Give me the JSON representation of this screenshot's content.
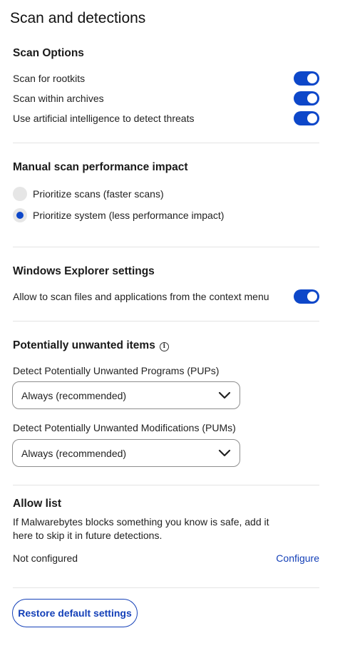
{
  "page": {
    "title": "Scan and detections"
  },
  "scan_options": {
    "heading": "Scan Options",
    "items": [
      {
        "label": "Scan for rootkits",
        "enabled": true
      },
      {
        "label": "Scan within archives",
        "enabled": true
      },
      {
        "label": "Use artificial intelligence to detect threats",
        "enabled": true
      }
    ]
  },
  "performance": {
    "heading": "Manual scan performance impact",
    "options": [
      {
        "label": "Prioritize scans (faster scans)",
        "selected": false
      },
      {
        "label": "Prioritize system (less performance impact)",
        "selected": true
      }
    ]
  },
  "explorer": {
    "heading": "Windows Explorer settings",
    "items": [
      {
        "label": "Allow to scan files and applications from the context menu",
        "enabled": true
      }
    ]
  },
  "pup": {
    "heading": "Potentially unwanted items",
    "info_icon": "info-icon",
    "programs_label": "Detect Potentially Unwanted Programs (PUPs)",
    "programs_value": "Always (recommended)",
    "modifications_label": "Detect Potentially Unwanted Modifications (PUMs)",
    "modifications_value": "Always (recommended)"
  },
  "allow_list": {
    "heading": "Allow list",
    "description": "If Malwarebytes blocks something you know is safe, add it here to skip it in future detections.",
    "status": "Not configured",
    "configure_label": "Configure"
  },
  "footer": {
    "restore_label": "Restore default settings"
  },
  "colors": {
    "accent": "#0d47c9",
    "link": "#1440b8",
    "divider": "#e4e4e4"
  }
}
